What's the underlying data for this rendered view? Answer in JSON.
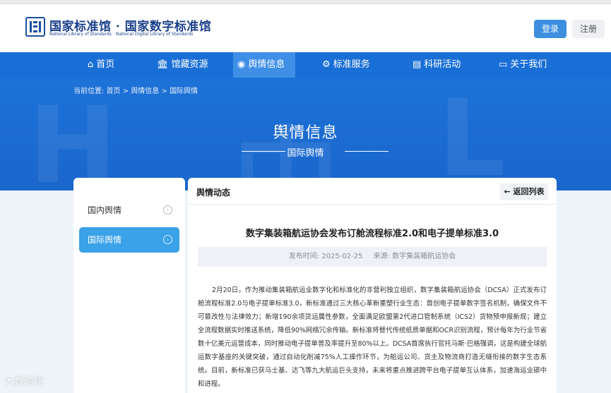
{
  "header": {
    "logo_cn": "国家标准馆 · 国家数字标准馆",
    "logo_en_left": "National Library of Standards",
    "logo_en_right": "National Digital Library of Standards",
    "login_label": "登录",
    "register_label": "注册"
  },
  "nav": {
    "items": [
      {
        "label": "首页",
        "icon": "home-icon"
      },
      {
        "label": "馆藏资源",
        "icon": "library-icon"
      },
      {
        "label": "舆情信息",
        "icon": "broadcast-icon",
        "active": true
      },
      {
        "label": "标准服务",
        "icon": "gear-icon"
      },
      {
        "label": "科研活动",
        "icon": "server-icon"
      },
      {
        "label": "关于我们",
        "icon": "message-icon"
      }
    ]
  },
  "breadcrumb": {
    "prefix": "当前位置:",
    "items": [
      "首页",
      "舆情信息",
      "国际舆情"
    ]
  },
  "banner": {
    "title": "舆情信息",
    "subtitle": "国际舆情"
  },
  "sidebar": {
    "items": [
      {
        "label": "国内舆情",
        "active": false
      },
      {
        "label": "国际舆情",
        "active": true
      }
    ]
  },
  "content": {
    "section_title": "舆情动态",
    "back_label": "返回列表",
    "article": {
      "title": "数字集装箱航运协会发布订舱流程标准2.0和电子提单标准3.0",
      "publish_time": "发布时间: 2025-02-25",
      "source": "来源: 数字集装箱航运协会",
      "body": "2月20日，作为推动集装箱航运业数字化和标准化的非营利独立组织，数字集装箱航运协会（DCSA）正式发布订舱流程标准2.0与电子提单标准3.0，新标准通过三大核心革新重塑行业生态：首创电子提单数字签名机制，确保文件不可篡改性与法律效力；新增190余项货运属性参数，全面满足欧盟第2代进口管制系统（ICS2）货物预申报新规；建立全流程数据实时推送系统，降低90%网络冗余传输。新标准将替代传统纸质单据和OCR识别流程，预计每年为行业节省数十亿美元运营成本，同时推动电子提单普及率提升至80%以上。DCSA首席执行官托马斯·巴格强调，这是构建全球航运数字基座的关键突破，通过自动化削减75%人工操作环节，为船运公司、货主及物流商打造无缝衔接的数字生态系统。目前，新标准已获马士基、达飞等九大航运巨头支持，未来将重点推进跨平台电子提单互认体系，加速海运业碳中和进程。"
    }
  },
  "watermark": "大数跨境"
}
